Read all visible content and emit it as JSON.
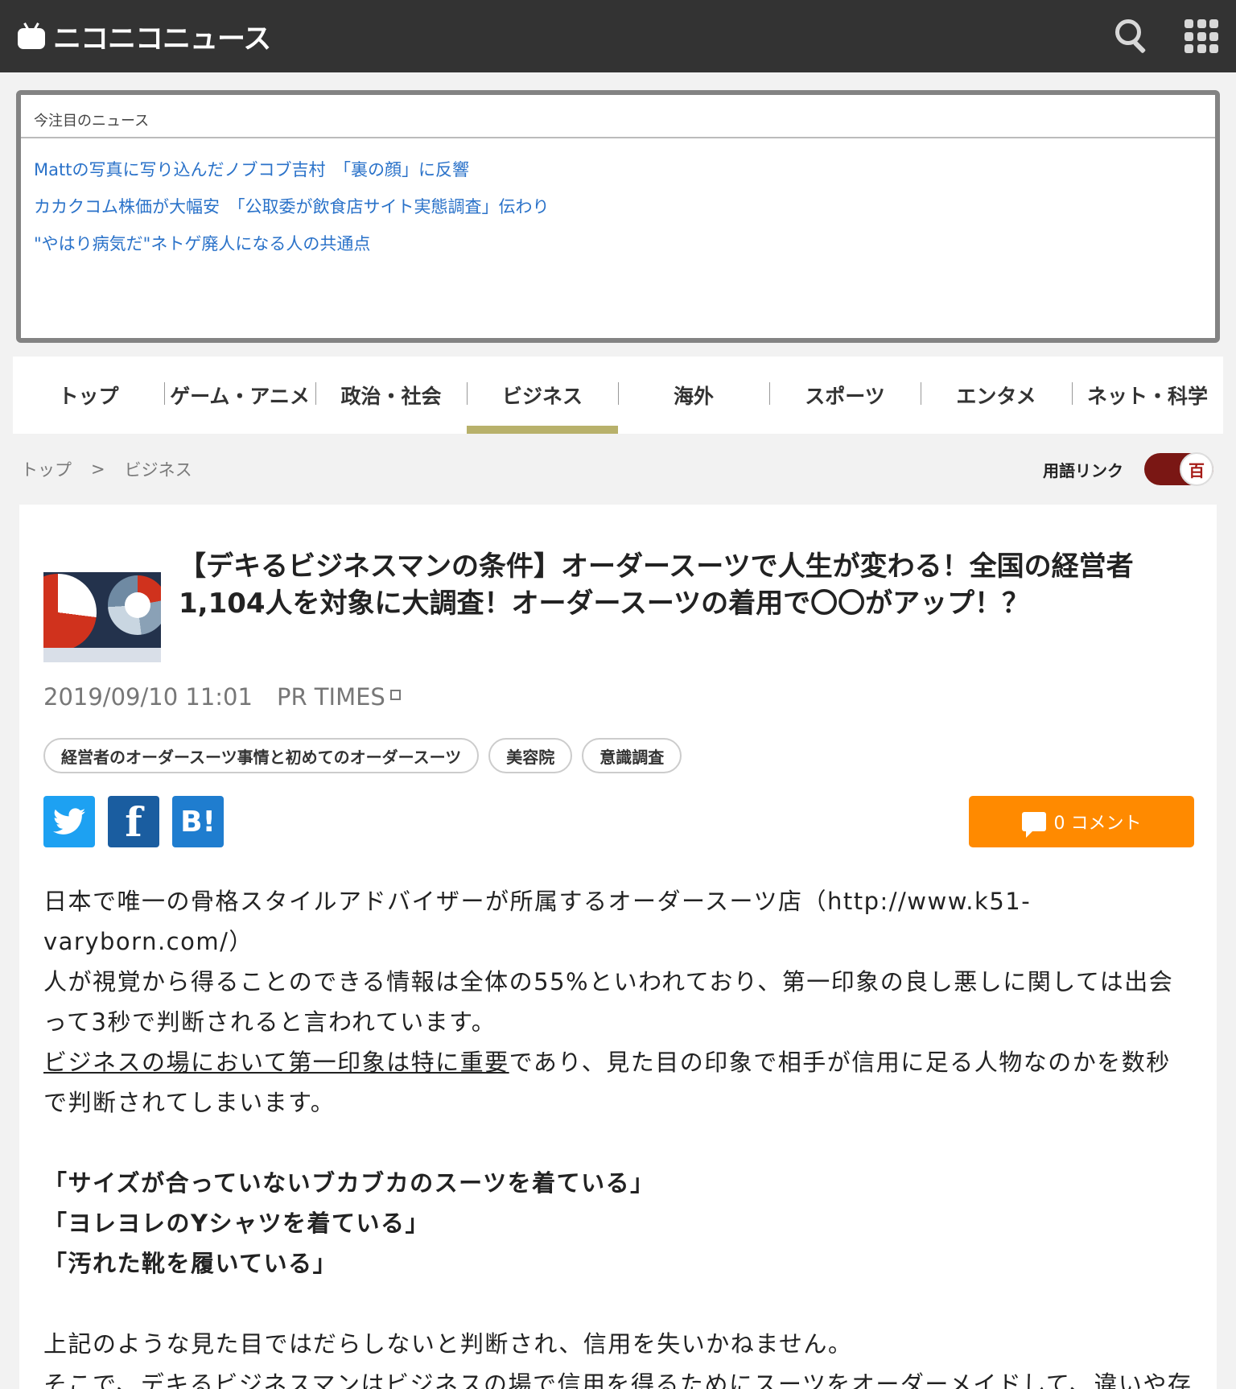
{
  "header": {
    "logo_text": "ニコニコニュース",
    "icons": [
      "search-icon",
      "apps-grid-icon"
    ]
  },
  "attention": {
    "heading": "今注目のニュース",
    "items": [
      "Mattの写真に写り込んだノブコブ吉村　「裏の顔」に反響",
      "カカクコム株価が大幅安　「公取委が飲食店サイト実態調査」伝わり",
      "\"やはり病気だ\"ネトゲ廃人になる人の共通点"
    ]
  },
  "nav": {
    "items": [
      "トップ",
      "ゲーム・アニメ",
      "政治・社会",
      "ビジネス",
      "海外",
      "スポーツ",
      "エンタメ",
      "ネット・科学"
    ],
    "active": "ビジネス"
  },
  "breadcrumb": {
    "home": "トップ",
    "separator": ">",
    "current": "ビジネス"
  },
  "term_link": {
    "label": "用語リンク",
    "toggle_glyph": "百"
  },
  "article": {
    "title": "【デキるビジネスマンの条件】オーダースーツで人生が変わる！全国の経営者1,104人を対象に大調査！オーダースーツの着用で〇〇がアップ！？",
    "date": "2019/09/10 11:01",
    "source": "PR TIMES",
    "tags": [
      "経営者のオーダースーツ事情と初めてのオーダースーツ",
      "美容院",
      "意識調査"
    ],
    "share": {
      "twitter_glyph": "🐦",
      "facebook_glyph": "f",
      "hatena_glyph": "B!"
    },
    "comment_label": "0 コメント",
    "paragraphs": {
      "p1": "日本で唯一の骨格スタイルアドバイザーが所属するオーダースーツ店（http://www.k51-varyborn.com/）",
      "p2": "人が視覚から得ることのできる情報は全体の55%といわれており、第一印象の良し悪しに関しては出会って3秒で判断されると言われています。",
      "p3a": "ビジネスの場において第一印象は特に重要",
      "p3b": "であり、見た目の印象で相手が信用に足る人物なのかを数秒で判断されてしまいます。",
      "q1": "「サイズが合っていないブカブカのスーツを着ている」",
      "q2": "「ヨレヨレのYシャツを着ている」",
      "q3": "「汚れた靴を履いている」",
      "p4": "上記のような見た目ではだらしないと判断され、信用を失いかねません。",
      "p5": "そこで、デキるビジネスマンはビジネスの場で信用を得るためにスーツをオーダーメイドして、違いや存在感を出しています。そういう姿勢がきちっとした印象を与えて好感度が上がり、部下に対しても影"
    }
  },
  "colors": {
    "header_bg": "#333333",
    "link_blue": "#2a72c9",
    "nav_active_bar": "#b8b16b",
    "comment_orange": "#ff8a00",
    "toggle_red": "#7a1714"
  }
}
